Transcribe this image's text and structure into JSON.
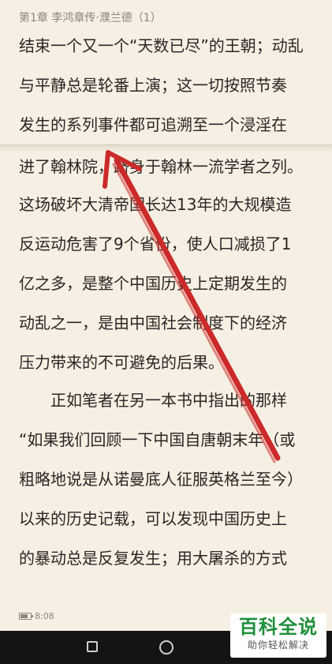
{
  "reader": {
    "chapter_title": "第1章 李鸿章传·濮兰德（1）",
    "lines": [
      "结束一个又一个“天数已尽”的王朝；动乱",
      "与平静总是轮番上演；这一切按照节奏",
      "发生的系列事件都可追溯至一个浸淫在",
      "进了翰林院，跻身于翰林一流学者之列。",
      "这场破坏大清帝国长达13年的大规模造",
      "反运动危害了9个省份，使人口减损了1",
      "亿之多，是整个中国历史上定期发生的",
      "动乱之一，是由中国社会制度下的经济",
      "压力带来的不可避免的后果。",
      "　　正如笔者在另一本书中指出的那样",
      "“如果我们回顾一下中国自唐朝末年（或",
      "粗略地说是从诺曼底人征服英格兰至今）",
      "以来的历史记载，可以发现中国历史上",
      "的暴动总是反复发生；用大屠杀的方式"
    ]
  },
  "status": {
    "time": "8:08",
    "battery_icon": "battery-icon"
  },
  "annotation": {
    "arrow_color": "#cc2a2a"
  },
  "nav": {
    "square_icon": "recent-apps-icon",
    "circle_icon": "home-icon"
  },
  "watermark": {
    "title": "百科全说",
    "subtitle": "助你轻松解决"
  }
}
